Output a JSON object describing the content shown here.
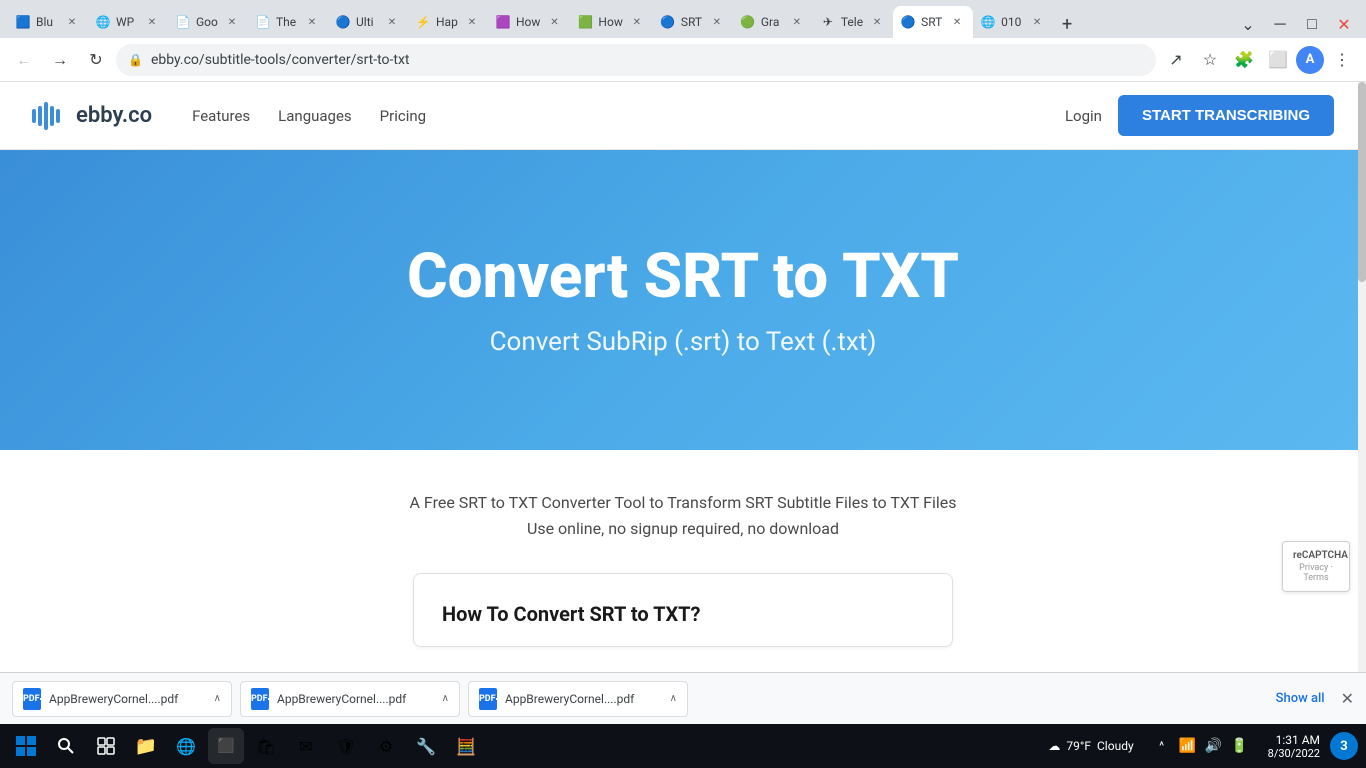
{
  "browser": {
    "tabs": [
      {
        "id": "blu",
        "label": "Blu",
        "favicon": "🟦",
        "active": false
      },
      {
        "id": "wp",
        "label": "WP",
        "favicon": "🌐",
        "active": false
      },
      {
        "id": "goo",
        "label": "Goo",
        "favicon": "📄",
        "active": false
      },
      {
        "id": "the",
        "label": "The",
        "favicon": "📄",
        "active": false
      },
      {
        "id": "ulti",
        "label": "Ulti",
        "favicon": "🔵",
        "active": false
      },
      {
        "id": "hap",
        "label": "Hap",
        "favicon": "⚡",
        "active": false
      },
      {
        "id": "how1",
        "label": "How",
        "favicon": "🟪",
        "active": false
      },
      {
        "id": "how2",
        "label": "How",
        "favicon": "🟩",
        "active": false
      },
      {
        "id": "srt1",
        "label": "SRT",
        "favicon": "🔵",
        "active": false
      },
      {
        "id": "gra",
        "label": "Gra",
        "favicon": "🟢",
        "active": false
      },
      {
        "id": "tele",
        "label": "Tele",
        "favicon": "✈",
        "active": false
      },
      {
        "id": "srt2",
        "label": "SRT",
        "favicon": "🔵",
        "active": true
      },
      {
        "id": "010",
        "label": "010",
        "favicon": "🌐",
        "active": false
      }
    ],
    "address": "ebby.co/subtitle-tools/converter/srt-to-txt",
    "window_controls": {
      "minimize": "─",
      "maximize": "□",
      "close": "✕"
    }
  },
  "site": {
    "logo_text": "ebby.co",
    "nav_links": [
      {
        "label": "Features"
      },
      {
        "label": "Languages"
      },
      {
        "label": "Pricing"
      }
    ],
    "login_label": "Login",
    "cta_label": "START TRANSCRIBING"
  },
  "hero": {
    "title": "Convert SRT to TXT",
    "subtitle": "Convert SubRip (.srt) to Text (.txt)"
  },
  "content": {
    "description_line1": "A Free SRT to TXT Converter Tool to Transform SRT Subtitle Files to TXT Files",
    "description_line2": "Use online, no signup required, no download",
    "how_to_title": "How To Convert SRT to TXT?"
  },
  "recaptcha": {
    "text": "reCAPTCHA",
    "subtext": "Privacy · Terms"
  },
  "downloads": {
    "items": [
      {
        "name": "AppBreweryCornel....pdf"
      },
      {
        "name": "AppBreweryCornel....pdf"
      },
      {
        "name": "AppBreweryCornel....pdf"
      }
    ],
    "show_all_label": "Show all",
    "close_label": "✕"
  },
  "taskbar": {
    "weather_temp": "79°F",
    "weather_desc": "Cloudy",
    "time": "1:31 AM",
    "date": "8/30/2022",
    "notification_count": "3"
  },
  "icons": {
    "back": "←",
    "forward": "→",
    "refresh": "↻",
    "home": "⌂",
    "lock": "🔒",
    "star": "☆",
    "extensions": "🧩",
    "sidebar": "⬜",
    "profile": "A",
    "menu": "⋮"
  }
}
